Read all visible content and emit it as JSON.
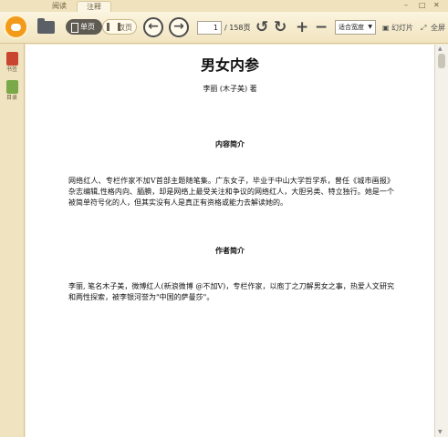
{
  "tabs": [
    {
      "label": "阅读"
    },
    {
      "label": "注释"
    }
  ],
  "window_controls": {
    "minimize": "–",
    "maximize": "□",
    "close": "✕"
  },
  "toolbar": {
    "single_page_label": "单页",
    "double_page_label": "双页",
    "prev_symbol": "←",
    "next_symbol": "→",
    "page_current": "1",
    "page_total": "/ 158页",
    "rotate_left_symbol": "↺",
    "rotate_right_symbol": "↻",
    "zoom_in_symbol": "+",
    "zoom_out_symbol": "−",
    "zoom_mode": "适合宽度",
    "slideshow_label": "幻灯片",
    "fullscreen_label": "全屏",
    "icons": [
      "app-logo-icon",
      "open-folder-icon",
      "single-page-icon",
      "double-page-icon",
      "previous-page-icon",
      "next-page-icon",
      "rotate-left-icon",
      "rotate-right-icon",
      "zoom-in-icon",
      "zoom-out-icon",
      "slideshow-icon",
      "fullscreen-icon"
    ]
  },
  "left_rail": {
    "bookmarks_label": "书签",
    "toc_label": "目录"
  },
  "document": {
    "title": "男女内参",
    "author": "李丽 (木子美) 著",
    "sections": [
      {
        "heading": "内容简介",
        "text": "网络红人、专栏作家不加V首部主题随笔集。广东女子，毕业于中山大学哲学系，曾任《城市画报》杂志编辑,性格内向、腼腆，却是网络上最受关注和争议的网络红人，大胆另类、特立独行。她是一个被简单符号化的人，但其实没有人是真正有资格或能力去解读她的。"
      },
      {
        "heading": "作者简介",
        "text": "李丽, 笔名木子美，微博红人(新浪微博 @不加V)，专栏作家，以庖丁之刀解男女之事，热爱人文研究和两性探索，被李银河誉为\"中国的萨曼莎\"。"
      }
    ]
  },
  "colors": {
    "accent": "#f39a1b",
    "toolbar_bg": "#f1e4c0",
    "page_bg": "#ffffff",
    "bookmark_icon": "#c9452f",
    "toc_icon": "#79a948"
  }
}
